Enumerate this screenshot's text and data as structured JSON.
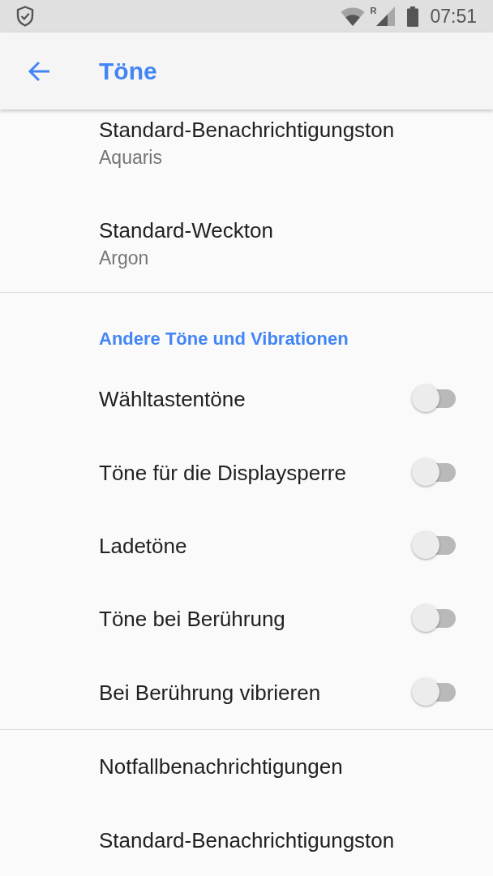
{
  "status_bar": {
    "roaming_indicator": "R",
    "time": "07:51"
  },
  "app_bar": {
    "title": "Töne"
  },
  "sections": [
    {
      "items": [
        {
          "kind": "link",
          "title": "Standard-Benachrichtigungston",
          "summary": "Aquaris"
        },
        {
          "kind": "link",
          "title": "Standard-Weckton",
          "summary": "Argon"
        }
      ]
    },
    {
      "header": "Andere Töne und Vibrationen",
      "items": [
        {
          "kind": "switch",
          "title": "Wähltastentöne",
          "on": false
        },
        {
          "kind": "switch",
          "title": "Töne für die Displaysperre",
          "on": false
        },
        {
          "kind": "switch",
          "title": "Ladetöne",
          "on": false
        },
        {
          "kind": "switch",
          "title": "Töne bei Berührung",
          "on": false
        },
        {
          "kind": "switch",
          "title": "Bei Berührung vibrieren",
          "on": false
        }
      ]
    },
    {
      "items": [
        {
          "kind": "link",
          "title": "Notfallbenachrichtigungen"
        },
        {
          "kind": "link",
          "title": "Standard-Benachrichtigungston"
        }
      ]
    }
  ]
}
